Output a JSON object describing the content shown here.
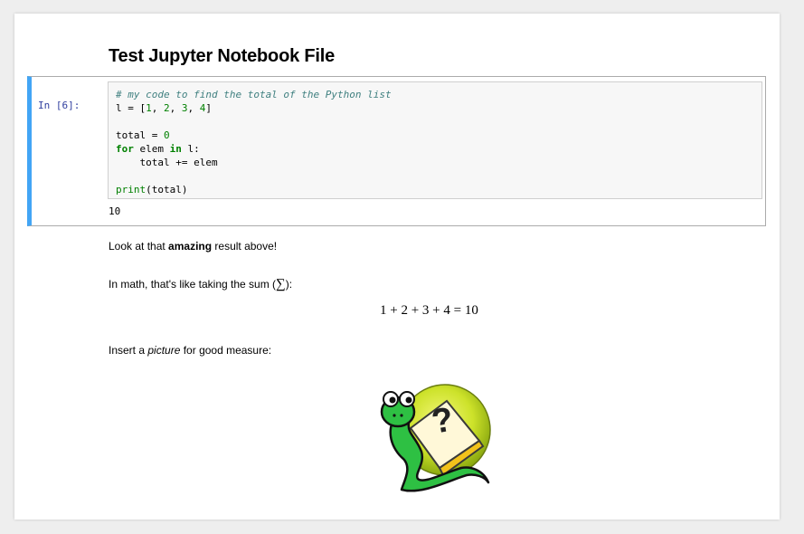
{
  "notebook": {
    "title": "Test Jupyter Notebook File",
    "cell": {
      "prompt": "In [6]:",
      "code": {
        "line1_comment": "# my code to find the total of the Python list",
        "line2_var": "l",
        "line2_eq": " = [",
        "line2_n1": "1",
        "line2_n2": "2",
        "line2_n3": "3",
        "line2_n4": "4",
        "line4_var": "total",
        "line4_eq": " = ",
        "line4_num": "0",
        "line5_for": "for",
        "line5_elem": " elem ",
        "line5_in": "in",
        "line5_rest": " l:",
        "line6": "    total += elem",
        "line8_print": "print",
        "line8_rest": "(total)"
      },
      "output": "10"
    },
    "markdown": {
      "p1_before": "Look at that ",
      "p1_bold": "amazing",
      "p1_after": " result above!",
      "p2_text": "In math, that's like taking the sum (",
      "p2_symbol": "∑",
      "p2_end": "):",
      "equation": "1 + 2 + 3 + 4 = 10",
      "p3_before": "Insert a ",
      "p3_italic": "picture",
      "p3_after": " for good measure:"
    }
  },
  "colors": {
    "prompt": "#303f9f",
    "cell_border_selected": "#42a5f5",
    "code_background": "#f7f7f7",
    "comment": "#408080",
    "keyword": "#008000"
  },
  "image": {
    "icon": "python-snake-help-icon"
  }
}
